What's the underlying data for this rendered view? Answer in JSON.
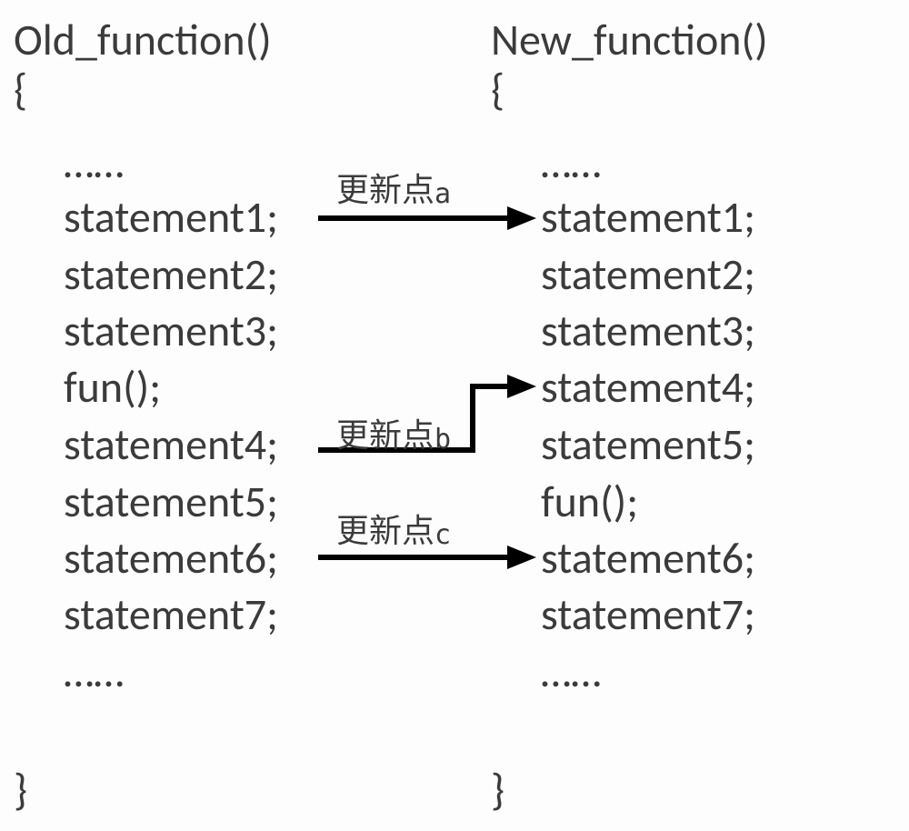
{
  "left": {
    "title": "Old_function()",
    "open": "{",
    "lines": [
      "……",
      "statement1;",
      "statement2;",
      "statement3;",
      "fun();",
      "statement4;",
      "statement5;",
      "statement6;",
      "statement7;",
      "……"
    ],
    "close": "}"
  },
  "right": {
    "title": "New_function()",
    "open": "{",
    "lines": [
      "……",
      "statement1;",
      "statement2;",
      "statement3;",
      "statement4;",
      "statement5;",
      "fun();",
      "statement6;",
      "statement7;",
      "……"
    ],
    "close": "}"
  },
  "labels": {
    "a_prefix": "更新点",
    "a_sub": "a",
    "b_prefix": "更新点",
    "b_sub": "b",
    "c_prefix": "更新点",
    "c_sub": "c"
  }
}
